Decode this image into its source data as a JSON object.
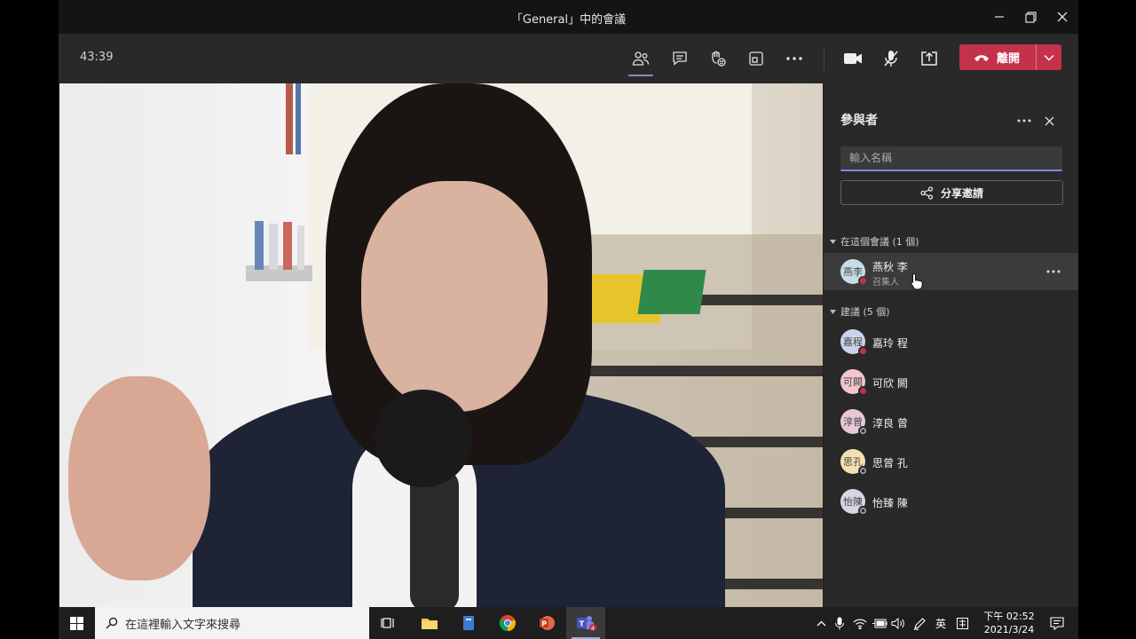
{
  "window": {
    "title": "「General」中的會議",
    "min": "—",
    "close": "✕"
  },
  "callbar": {
    "timer": "43:39",
    "leave_label": "離開"
  },
  "panel": {
    "title": "參與者",
    "search_placeholder": "輸入名稱",
    "share_label": "分享邀請",
    "in_meeting": {
      "label": "在這個會議 (1 個)",
      "people": [
        {
          "initials": "燕李",
          "name": "燕秋 李",
          "role": "召集人",
          "avatar_bg": "#c8dce6",
          "status": "busy"
        }
      ]
    },
    "suggested": {
      "label": "建議 (5 個)",
      "people": [
        {
          "initials": "嘉程",
          "name": "嘉玲 程",
          "avatar_bg": "#c9d4ea",
          "status": "busy"
        },
        {
          "initials": "可闕",
          "name": "可欣 闕",
          "avatar_bg": "#f2c6cc",
          "status": "busy"
        },
        {
          "initials": "淳曾",
          "name": "淳良 曾",
          "avatar_bg": "#e8c8d8",
          "status": "offline"
        },
        {
          "initials": "思孔",
          "name": "思曾 孔",
          "avatar_bg": "#f3dfb0",
          "status": "offline"
        },
        {
          "initials": "怡陳",
          "name": "怡臻 陳",
          "avatar_bg": "#d6d6e6",
          "status": "offline"
        }
      ]
    }
  },
  "taskbar": {
    "search_text": "在這裡輸入文字來搜尋",
    "teams_badge": "4",
    "ime": "英",
    "clock_time": "下午 02:52",
    "clock_date": "2021/3/24"
  },
  "colors": {
    "accent": "#7f85f5",
    "leave": "#c4314b",
    "busy": "#c4314b"
  }
}
